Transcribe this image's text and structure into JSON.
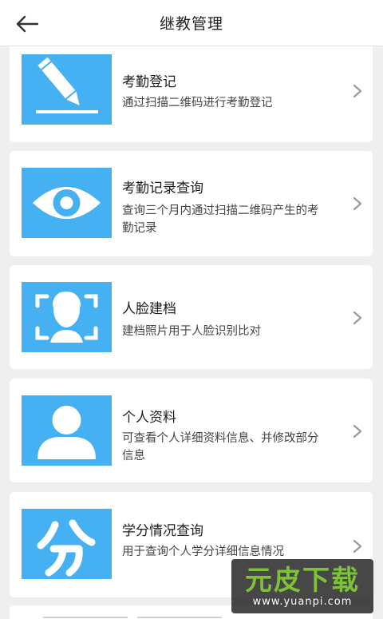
{
  "header": {
    "title": "继教管理",
    "back_icon": "arrow-left-icon"
  },
  "items": [
    {
      "title": "考勤登记",
      "desc": "通过扫描二维码进行考勤登记",
      "icon": "pencil-icon"
    },
    {
      "title": "考勤记录查询",
      "desc": "查询三个月内通过扫描二维码产生的考勤记录",
      "icon": "eye-icon"
    },
    {
      "title": "人脸建档",
      "desc": "建档照片用于人脸识别比对",
      "icon": "face-scan-icon"
    },
    {
      "title": "个人资料",
      "desc": "可查看个人详细资料信息、并修改部分信息",
      "icon": "user-icon"
    },
    {
      "title": "学分情况查询",
      "desc": "用于查询个人学分详细信息情况",
      "icon": "fen-icon"
    }
  ],
  "watermark": {
    "main": "元皮下载",
    "url": "www.yuanpi.com"
  },
  "colors": {
    "accent": "#45b1f3",
    "background": "#efefef",
    "card": "#ffffff"
  }
}
